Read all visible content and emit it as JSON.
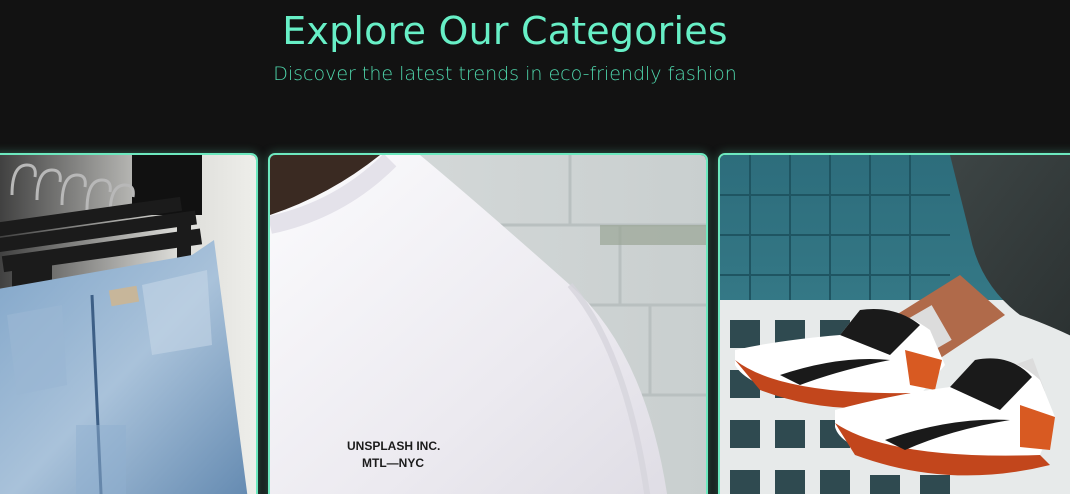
{
  "section": {
    "title": "Explore Our Categories",
    "subtitle": "Discover the latest trends in eco-friendly fashion"
  },
  "categories": [
    {
      "id": "jeans",
      "image": "jeans-on-hangers-photo"
    },
    {
      "id": "tshirt",
      "image": "white-tshirt-photo",
      "print_line1": "UNSPLASH INC.",
      "print_line2": "MTL—NYC"
    },
    {
      "id": "sneakers",
      "image": "sneakers-photo"
    }
  ],
  "colors": {
    "background": "#121212",
    "accent": "#67efc6",
    "card_border": "#6de9bf"
  }
}
